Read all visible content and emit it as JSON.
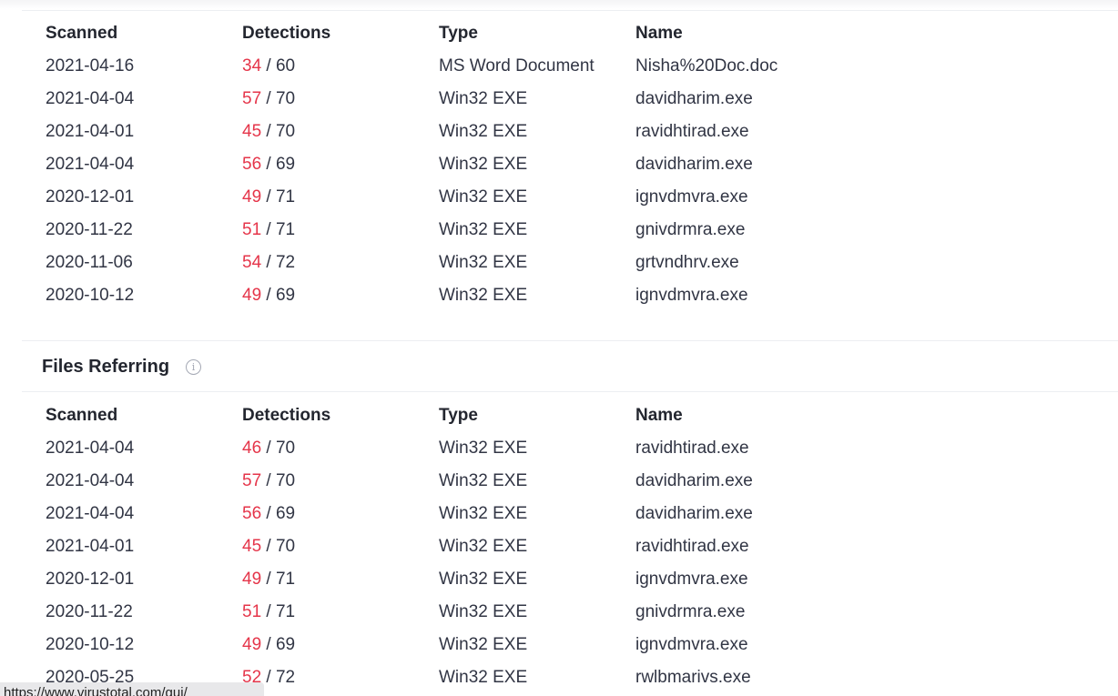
{
  "headers": {
    "scanned": "Scanned",
    "detections": "Detections",
    "type": "Type",
    "name": "Name"
  },
  "files_table": {
    "rows": [
      {
        "scanned": "2021-04-16",
        "positives": "34",
        "total": " / 60",
        "type": "MS Word Document",
        "name": "Nisha%20Doc.doc"
      },
      {
        "scanned": "2021-04-04",
        "positives": "57",
        "total": " / 70",
        "type": "Win32 EXE",
        "name": "davidharim.exe"
      },
      {
        "scanned": "2021-04-01",
        "positives": "45",
        "total": " / 70",
        "type": "Win32 EXE",
        "name": "ravidhtirad.exe"
      },
      {
        "scanned": "2021-04-04",
        "positives": "56",
        "total": " / 69",
        "type": "Win32 EXE",
        "name": "davidharim.exe"
      },
      {
        "scanned": "2020-12-01",
        "positives": "49",
        "total": " / 71",
        "type": "Win32 EXE",
        "name": "ignvdmvra.exe"
      },
      {
        "scanned": "2020-11-22",
        "positives": "51",
        "total": " / 71",
        "type": "Win32 EXE",
        "name": "gnivdrmra.exe"
      },
      {
        "scanned": "2020-11-06",
        "positives": "54",
        "total": " / 72",
        "type": "Win32 EXE",
        "name": "grtvndhrv.exe"
      },
      {
        "scanned": "2020-10-12",
        "positives": "49",
        "total": " / 69",
        "type": "Win32 EXE",
        "name": "ignvdmvra.exe"
      }
    ]
  },
  "files_referring": {
    "title": "Files Referring",
    "info_icon_glyph": "i",
    "rows": [
      {
        "scanned": "2021-04-04",
        "positives": "46",
        "total": " / 70",
        "type": "Win32 EXE",
        "name": "ravidhtirad.exe"
      },
      {
        "scanned": "2021-04-04",
        "positives": "57",
        "total": " / 70",
        "type": "Win32 EXE",
        "name": "davidharim.exe"
      },
      {
        "scanned": "2021-04-04",
        "positives": "56",
        "total": " / 69",
        "type": "Win32 EXE",
        "name": "davidharim.exe"
      },
      {
        "scanned": "2021-04-01",
        "positives": "45",
        "total": " / 70",
        "type": "Win32 EXE",
        "name": "ravidhtirad.exe"
      },
      {
        "scanned": "2020-12-01",
        "positives": "49",
        "total": " / 71",
        "type": "Win32 EXE",
        "name": "ignvdmvra.exe"
      },
      {
        "scanned": "2020-11-22",
        "positives": "51",
        "total": " / 71",
        "type": "Win32 EXE",
        "name": "gnivdrmra.exe"
      },
      {
        "scanned": "2020-10-12",
        "positives": "49",
        "total": " / 69",
        "type": "Win32 EXE",
        "name": "ignvdmvra.exe"
      },
      {
        "scanned": "2020-05-25",
        "positives": "52",
        "total": " / 72",
        "type": "Win32 EXE",
        "name": "rwlbmarivs.exe"
      }
    ]
  },
  "status_bar": {
    "url": "https://www.virustotal.com/gui/"
  },
  "colors": {
    "detection_positive": "#e5354a",
    "text": "#313544",
    "heading": "#23262f"
  }
}
